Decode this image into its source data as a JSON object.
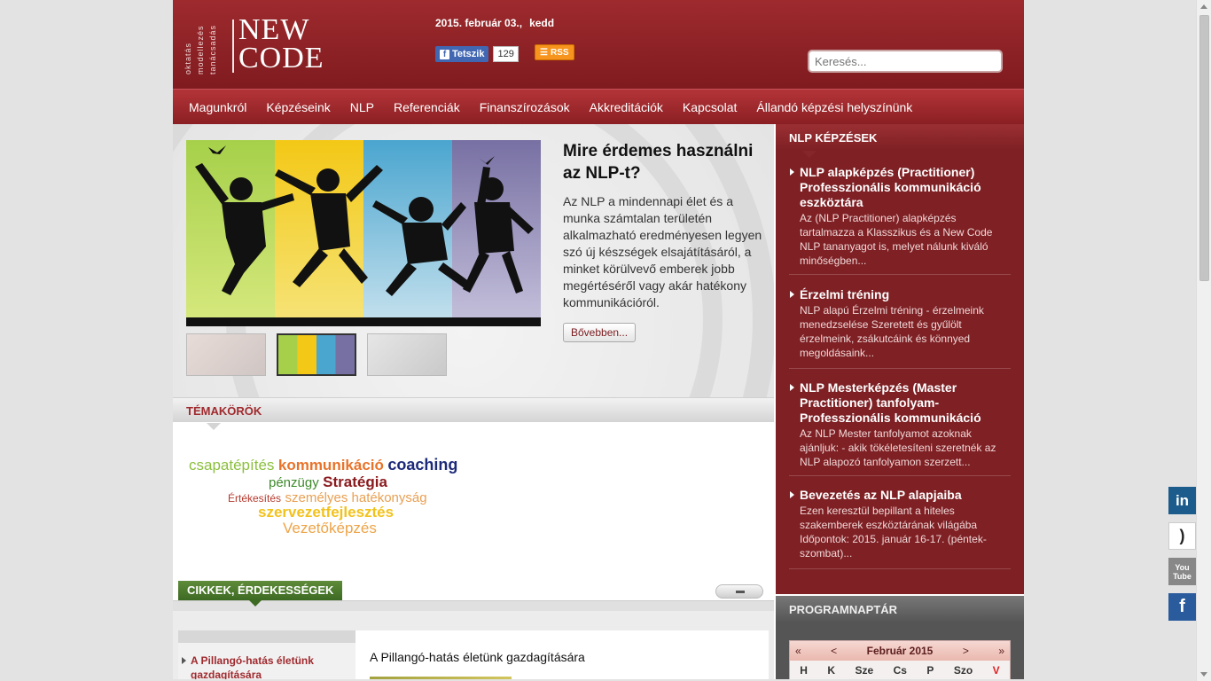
{
  "header": {
    "logo_small": [
      "oktatás",
      "modellezés",
      "tanácsadás"
    ],
    "logo_big": [
      "NEW",
      "CODE"
    ],
    "date": "2015. február 03.,",
    "weekday": "kedd",
    "fb_like_label": "Tetszik",
    "fb_like_count": "129",
    "rss_label": "RSS",
    "search_placeholder": "Keresés..."
  },
  "nav": [
    "Magunkról",
    "Képzéseink",
    "NLP",
    "Referenciák",
    "Finanszírozások",
    "Akkreditációk",
    "Kapcsolat",
    "Állandó képzési helyszínünk"
  ],
  "slider": {
    "title": "Mire érdemes használni az NLP-t?",
    "text": "Az NLP a mindennapi élet és a munka számtalan területén alkalmazható eredményesen legyen szó új készségek elsajátításáról, a minket körülvevő emberek jobb megértéséről vagy akár hatékony kommunikációról.",
    "more": "Bővebben..."
  },
  "topics": {
    "label": "TÉMAKÖRÖK",
    "tags": [
      {
        "text": "csapatépítés",
        "color": "#8cbf3f"
      },
      {
        "text": "kommunikáció",
        "color": "#e8732a"
      },
      {
        "text": "coaching",
        "color": "#1d2a7a"
      },
      {
        "text": "pénzügy",
        "color": "#3d8a2a"
      },
      {
        "text": "Stratégia",
        "color": "#8a1a1e"
      },
      {
        "text": "Értékesítés",
        "color": "#b5382c"
      },
      {
        "text": "személyes hatékonyság",
        "color": "#e9a052"
      },
      {
        "text": "szervezetfejlesztés",
        "color": "#f2c21c"
      },
      {
        "text": "Vezetőképzés",
        "color": "#eea448"
      }
    ]
  },
  "articles": {
    "label": "CIKKEK, ÉRDEKESSÉGEK",
    "side_item": "A Pillangó-hatás életünk gazdagítására",
    "main_title": "A Pillangó-hatás életünk gazdagítására"
  },
  "nlp": {
    "label": "NLP KÉPZÉSEK",
    "items": [
      {
        "title": "NLP alapképzés (Practitioner) Professzionális kommunikáció eszköztára",
        "desc": "Az (NLP Practitioner) alapképzés tartalmazza a Klasszikus és a New Code NLP tananyagot is, melyet nálunk kiváló minőségben..."
      },
      {
        "title": "Érzelmi tréning",
        "desc": "NLP alapú Érzelmi tréning - érzelmeink menedzselése Szeretett és gyűlölt érzelmeink, zsákutcáink és könnyed megoldásaink..."
      },
      {
        "title": "NLP Mesterképzés (Master Practitioner) tanfolyam- Professzionális kommunikáció",
        "desc": "Az NLP Mester tanfolyamot azoknak ajánljuk: -  akik tökéletesíteni szeretnék az NLP alapozó tanfolyamon szerzett..."
      },
      {
        "title": "Bevezetés az NLP alapjaiba",
        "desc": "Ezen keresztül bepillant a hiteles szakemberek eszköztárának világába Időpontok:    2015. január 16-17. (péntek-szombat)..."
      }
    ]
  },
  "calendar": {
    "label": "PROGRAMNAPTÁR",
    "prev2": "«",
    "prev": "<",
    "month": "Február 2015",
    "next": ">",
    "next2": "»",
    "days": [
      "H",
      "K",
      "Sze",
      "Cs",
      "P",
      "Szo",
      "V"
    ]
  },
  "social": {
    "linkedin": "in",
    "youtube_1": "You",
    "youtube_2": "Tube",
    "facebook": "f"
  }
}
